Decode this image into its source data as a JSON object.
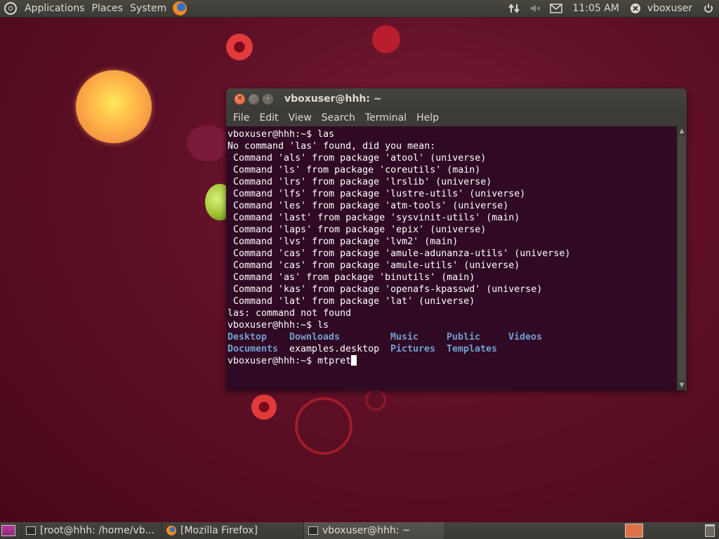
{
  "top_panel": {
    "menus": [
      "Applications",
      "Places",
      "System"
    ],
    "clock": "11:05 AM",
    "user": "vboxuser",
    "icons": {
      "logo": "ubuntu-logo-icon",
      "browser": "firefox-icon",
      "network": "network-arrows-icon",
      "sound": "sound-muted-icon",
      "mail": "mail-envelope-icon",
      "user": "user-x-icon",
      "power": "power-icon"
    }
  },
  "terminal": {
    "title": "vboxuser@hhh: ~",
    "menu": [
      "File",
      "Edit",
      "View",
      "Search",
      "Terminal",
      "Help"
    ],
    "lines": [
      "vboxuser@hhh:~$ las",
      "No command 'las' found, did you mean:",
      " Command 'als' from package 'atool' (universe)",
      " Command 'ls' from package 'coreutils' (main)",
      " Command 'lrs' from package 'lrslib' (universe)",
      " Command 'lfs' from package 'lustre-utils' (universe)",
      " Command 'les' from package 'atm-tools' (universe)",
      " Command 'last' from package 'sysvinit-utils' (main)",
      " Command 'laps' from package 'epix' (universe)",
      " Command 'lvs' from package 'lvm2' (main)",
      " Command 'cas' from package 'amule-adunanza-utils' (universe)",
      " Command 'cas' from package 'amule-utils' (universe)",
      " Command 'as' from package 'binutils' (main)",
      " Command 'kas' from package 'openafs-kpasswd' (universe)",
      " Command 'lat' from package 'lat' (universe)",
      "las: command not found",
      "vboxuser@hhh:~$ ls"
    ],
    "ls_output": [
      [
        {
          "text": "Desktop",
          "dir": true
        },
        {
          "text": "Downloads",
          "dir": true
        },
        {
          "text": "Music",
          "dir": true
        },
        {
          "text": "Public",
          "dir": true
        },
        {
          "text": "Videos",
          "dir": true
        }
      ],
      [
        {
          "text": "Documents",
          "dir": true
        },
        {
          "text": "examples.desktop",
          "dir": false
        },
        {
          "text": "Pictures",
          "dir": true
        },
        {
          "text": "Templates",
          "dir": true
        }
      ]
    ],
    "prompt": "vboxuser@hhh:~$ ",
    "current_input": "mtpret"
  },
  "taskbar": {
    "tasks": [
      {
        "label": "[root@hhh: /home/vb...",
        "icon": "terminal-icon",
        "active": false
      },
      {
        "label": "[Mozilla Firefox]",
        "icon": "firefox-icon",
        "active": false
      },
      {
        "label": "vboxuser@hhh: ~",
        "icon": "terminal-icon",
        "active": true
      }
    ]
  }
}
